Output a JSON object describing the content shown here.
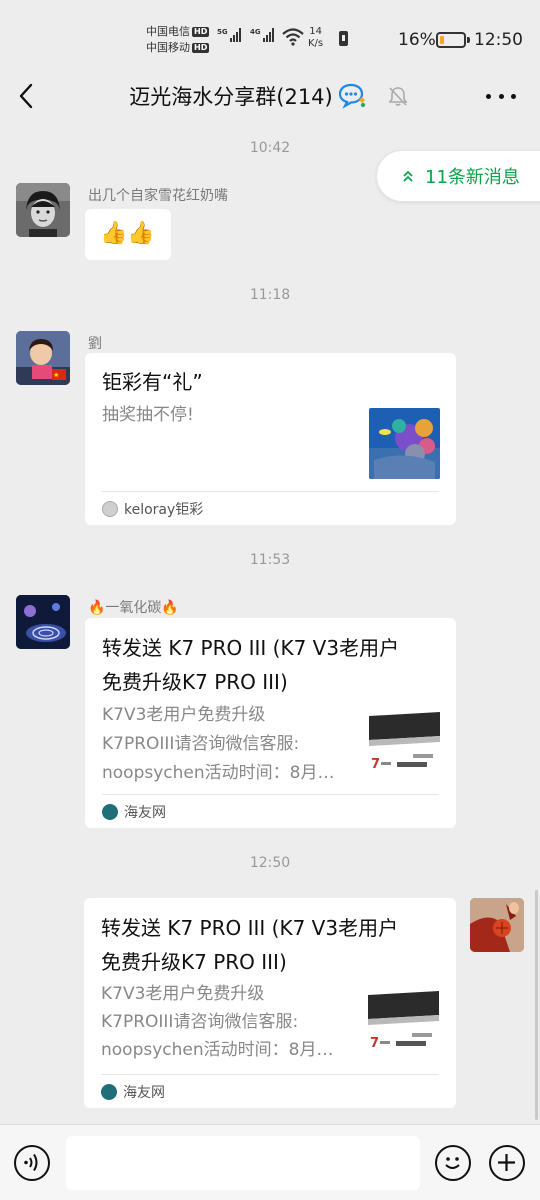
{
  "status_bar": {
    "carrier_1": "中国电信",
    "carrier_2": "中国移动",
    "hd_badge": "HD",
    "sig1_label": "5G",
    "sig2_label": "4G",
    "net_speed_value": "14",
    "net_speed_unit": "K/s",
    "battery_percent": "16%",
    "battery_level": 0.16,
    "time": "12:50"
  },
  "header": {
    "title": "迈光海水分享群(214)",
    "back_icon": "chevron-left-icon",
    "more_icon": "more-horizontal-icon"
  },
  "new_messages_label": "11条新消息",
  "chat": {
    "messages": [
      {
        "time": "10:42",
        "sender": "出几个自家雪花红奶嘴",
        "text": "👍👍"
      },
      {
        "time": "11:18",
        "sender": "劉",
        "card": {
          "title": "钜彩有“礼”",
          "desc": "抽奖抽不停!",
          "source": "keloray钜彩"
        }
      },
      {
        "time": "11:53",
        "sender": "🔥一氧化碳🔥",
        "card": {
          "title_l1": "转发送 K7 PRO III (K7 V3老用户",
          "title_l2": "免费升级K7 PRO III)",
          "desc_l1": "K7V3老用户免费升级",
          "desc_l2": "K7PROIII请咨询微信客服:",
          "desc_l3": "noopsychen活动时间：8月…",
          "source": "海友网"
        }
      },
      {
        "time": "12:50",
        "card": {
          "title_l1": "转发送 K7 PRO III (K7 V3老用户",
          "title_l2": "免费升级K7 PRO III)",
          "desc_l1": "K7V3老用户免费升级",
          "desc_l2": "K7PROIII请咨询微信客服:",
          "desc_l3": "noopsychen活动时间：8月…",
          "source": "海友网"
        }
      }
    ]
  },
  "colors": {
    "accent_green": "#07a64b",
    "background": "#ededed",
    "battery_fill": "#f5a623"
  }
}
